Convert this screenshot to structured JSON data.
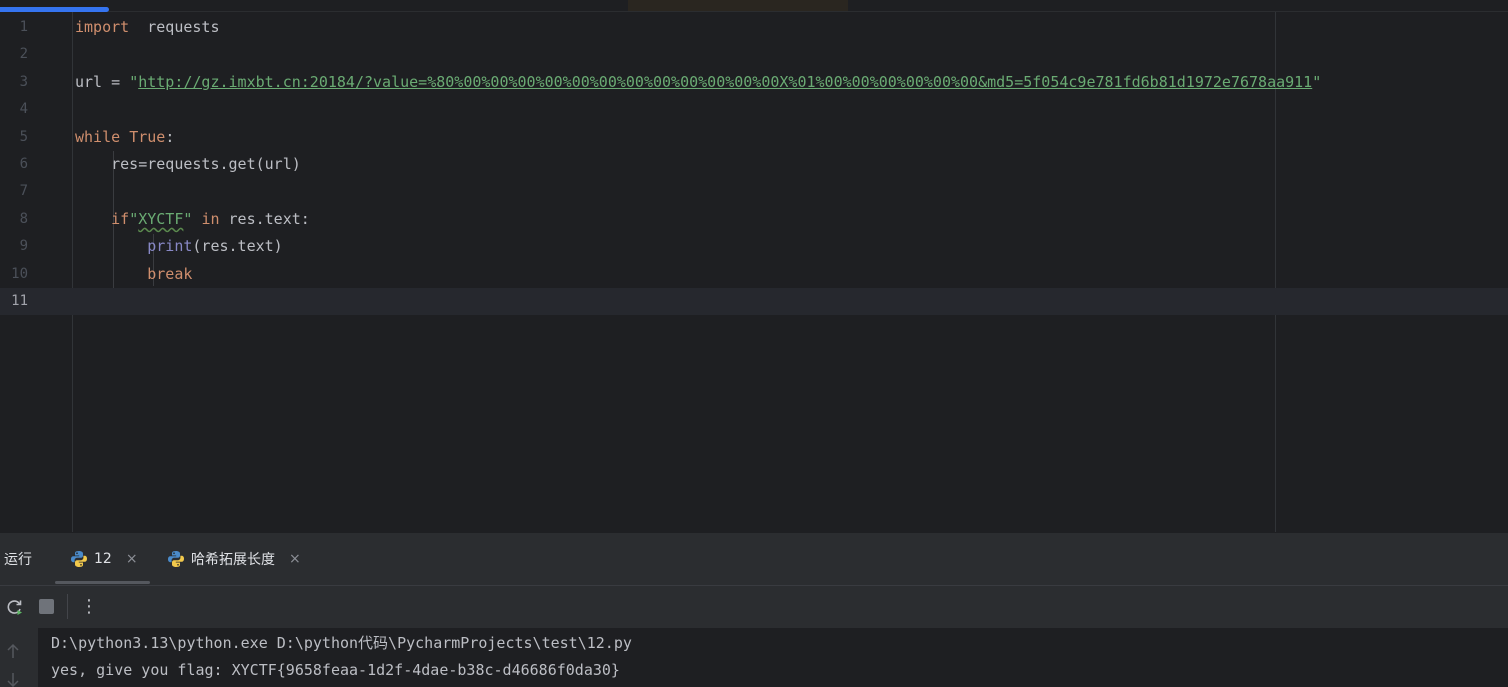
{
  "editor": {
    "current_line": 11,
    "lines": [
      {
        "n": "1",
        "parts": [
          [
            "kw",
            "import"
          ],
          [
            "plain",
            "  requests"
          ]
        ]
      },
      {
        "n": "2",
        "parts": []
      },
      {
        "n": "3",
        "parts": [
          [
            "plain",
            "url = "
          ],
          [
            "str",
            "\""
          ],
          [
            "url",
            "http://gz.imxbt.cn:20184/?value=%80%00%00%00%00%00%00%00%00%00%00%00%00X%01%00%00%00%00%00%00&md5=5f054c9e781fd6b81d1972e7678aa911"
          ],
          [
            "str",
            "\""
          ]
        ]
      },
      {
        "n": "4",
        "parts": []
      },
      {
        "n": "5",
        "parts": [
          [
            "kw",
            "while"
          ],
          [
            "plain",
            " "
          ],
          [
            "kw",
            "True"
          ],
          [
            "plain",
            ":"
          ]
        ]
      },
      {
        "n": "6",
        "parts": [
          [
            "plain",
            "    res=requests.get(url)"
          ]
        ]
      },
      {
        "n": "7",
        "parts": []
      },
      {
        "n": "8",
        "parts": [
          [
            "plain",
            "    "
          ],
          [
            "kw",
            "if"
          ],
          [
            "str",
            "\""
          ],
          [
            "strtypo",
            "XYCTF"
          ],
          [
            "str",
            "\""
          ],
          [
            "plain",
            " "
          ],
          [
            "kw",
            "in"
          ],
          [
            "plain",
            " res.text:"
          ]
        ]
      },
      {
        "n": "9",
        "parts": [
          [
            "plain",
            "        "
          ],
          [
            "fn",
            "print"
          ],
          [
            "plain",
            "(res.text)"
          ]
        ]
      },
      {
        "n": "10",
        "parts": [
          [
            "plain",
            "        "
          ],
          [
            "kw",
            "break"
          ]
        ]
      },
      {
        "n": "11",
        "parts": []
      }
    ]
  },
  "run_panel": {
    "label": "运行",
    "tabs": [
      {
        "label": "12",
        "close": "×"
      },
      {
        "label": "哈希拓展长度",
        "close": "×"
      }
    ],
    "toolbar": {
      "rerun_icon": "rerun-icon",
      "stop_icon": "stop-icon",
      "more_icon": "more-vertical-icon",
      "more_glyph": "⋮"
    },
    "console": {
      "command": "D:\\python3.13\\python.exe D:\\python代码\\PycharmProjects\\test\\12.py",
      "output": "yes, give you flag: XYCTF{9658feaa-1d2f-4dae-b38c-d46686f0da30}"
    }
  },
  "colors": {
    "keyword": "#cf8e6d",
    "string": "#6aab73",
    "builtin": "#8888c6",
    "text": "#bcbec4",
    "accent": "#3574f0"
  }
}
